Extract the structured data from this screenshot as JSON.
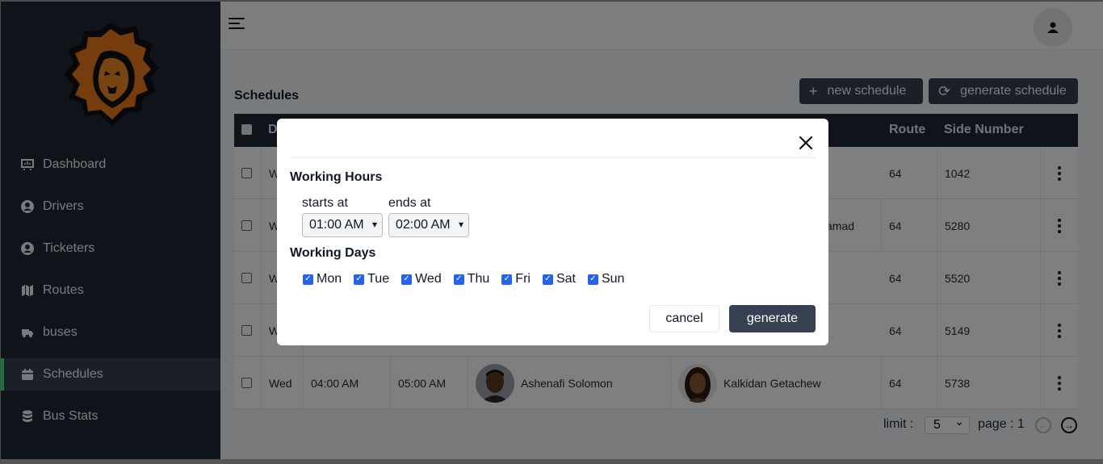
{
  "sidebar": {
    "items": [
      {
        "label": "Dashboard",
        "icon": "presentation-icon",
        "active": false
      },
      {
        "label": "Drivers",
        "icon": "user-circle-icon",
        "active": false
      },
      {
        "label": "Ticketers",
        "icon": "user-circle-icon",
        "active": false
      },
      {
        "label": "Routes",
        "icon": "map-icon",
        "active": false
      },
      {
        "label": "buses",
        "icon": "truck-icon",
        "active": false
      },
      {
        "label": "Schedules",
        "icon": "calendar-icon",
        "active": true
      },
      {
        "label": "Bus Stats",
        "icon": "database-icon",
        "active": false
      }
    ]
  },
  "page": {
    "title": "Schedules",
    "new_schedule_label": "new schedule",
    "generate_schedule_label": "generate schedule"
  },
  "table": {
    "headers": {
      "day": "D",
      "route": "Route",
      "side_number": "Side Number"
    },
    "partial_texts": {
      "row1_day": "W",
      "row2_day": "W",
      "row3_day": "W",
      "row4_day": "W",
      "row2_tail": "amad"
    },
    "rows": [
      {
        "day": "W",
        "route": "64",
        "side_number": "1042"
      },
      {
        "day": "W",
        "route": "64",
        "side_number": "5280"
      },
      {
        "day": "W",
        "route": "64",
        "side_number": "5520"
      },
      {
        "day": "W",
        "route": "64",
        "side_number": "5149"
      },
      {
        "day": "Wed",
        "start": "04:00 AM",
        "end": "05:00 AM",
        "driver": "Ashenafi  Solomon",
        "ticketer": "Kalkidan  Getachew",
        "route": "64",
        "side_number": "5738"
      }
    ]
  },
  "pagination": {
    "limit_label": "limit :",
    "limit_value": "5",
    "page_label": "page : 1"
  },
  "modal": {
    "working_hours_title": "Working Hours",
    "starts_at_label": "starts at",
    "ends_at_label": "ends at",
    "starts_at_value": "01:00 AM",
    "ends_at_value": "02:00 AM",
    "working_days_title": "Working Days",
    "days": [
      {
        "label": "Mon",
        "checked": true
      },
      {
        "label": "Tue",
        "checked": true
      },
      {
        "label": "Wed",
        "checked": true
      },
      {
        "label": "Thu",
        "checked": true
      },
      {
        "label": "Fri",
        "checked": true
      },
      {
        "label": "Sat",
        "checked": true
      },
      {
        "label": "Sun",
        "checked": true
      }
    ],
    "cancel_label": "cancel",
    "generate_label": "generate"
  },
  "colors": {
    "sidebar_bg": "#1f2937",
    "active_accent": "#4ade80",
    "button_dark": "#374151",
    "checkbox_blue": "#2563eb"
  }
}
